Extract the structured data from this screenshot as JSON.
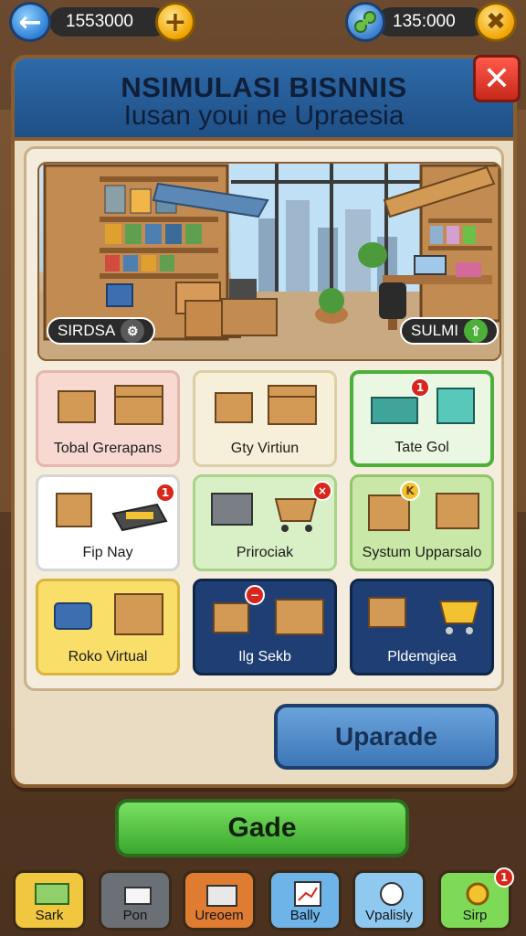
{
  "topbar": {
    "coins": "1553000",
    "gems": "135:000"
  },
  "panel": {
    "title_line1": "NSIMULASI BISNNIS",
    "title_line2": "Iusan youi ne Upraesia"
  },
  "scene": {
    "left_label": "SIRDSA",
    "right_label": "SULMI"
  },
  "cards": [
    {
      "label": "Tobal Grerapans",
      "bg": "#f7d9d2",
      "badge": ""
    },
    {
      "label": "Gty Virtiun",
      "bg": "#f6efd9",
      "badge": ""
    },
    {
      "label": "Tate Gol",
      "bg": "#eaf7e3",
      "badge": "1"
    },
    {
      "label": "Fip Nay",
      "bg": "#ffffff",
      "badge": "1"
    },
    {
      "label": "Prirociak",
      "bg": "#d9f0c6",
      "badge": "×"
    },
    {
      "label": "Systum Upparsalo",
      "bg": "#c9e7a6",
      "badge": "K"
    },
    {
      "label": "Roko Virtual",
      "bg": "#f9de6a",
      "badge": ""
    },
    {
      "label": "Ilg Sekb",
      "bg": "#1f3f74",
      "badge": "−"
    },
    {
      "label": "Pldemgiea",
      "bg": "#1f3f74",
      "badge": ""
    }
  ],
  "buttons": {
    "upgrade": "Uparade",
    "primary": "Gade"
  },
  "nav": [
    {
      "label": "Sark",
      "bg": "#f1c740"
    },
    {
      "label": "Pon",
      "bg": "#6b6f76"
    },
    {
      "label": "Ureoem",
      "bg": "#e07b32"
    },
    {
      "label": "Bally",
      "bg": "#6fb4e8"
    },
    {
      "label": "Vpalisly",
      "bg": "#8fc9f0"
    },
    {
      "label": "Sirp",
      "bg": "#7ed957",
      "badge": "1"
    }
  ]
}
